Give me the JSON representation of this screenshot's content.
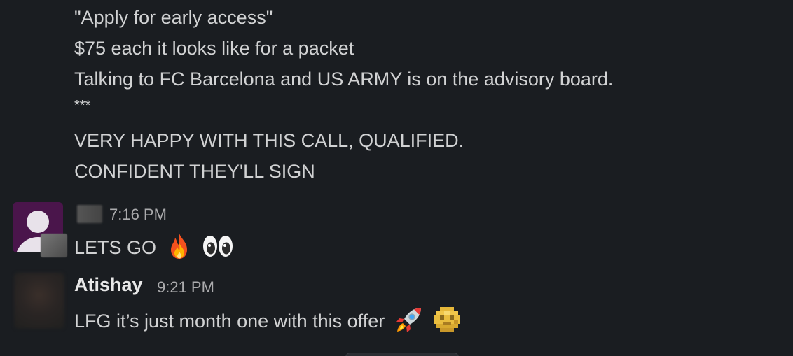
{
  "continuation": {
    "lines": [
      "\"Apply for early access\"",
      "$75 each it looks like for a packet",
      "Talking to FC Barcelona and US ARMY is on the advisory board.",
      "***",
      "VERY HAPPY WITH THIS CALL, QUALIFIED.",
      "CONFIDENT THEY'LL SIGN"
    ]
  },
  "messages": [
    {
      "sender": "",
      "timestamp": "7:16 PM",
      "text": "LETS GO",
      "emojis": [
        "fire-icon",
        "eyes-icon"
      ]
    },
    {
      "sender": "Atishay",
      "timestamp": "9:21 PM",
      "text": "LFG it’s just month one with this offer",
      "emojis": [
        "rocket-icon",
        "pixelated-emoji-icon"
      ]
    }
  ],
  "colors": {
    "background": "#1a1d21",
    "text": "#d1d2d3",
    "timestamp": "#ababad",
    "avatar": "#4a154b"
  }
}
